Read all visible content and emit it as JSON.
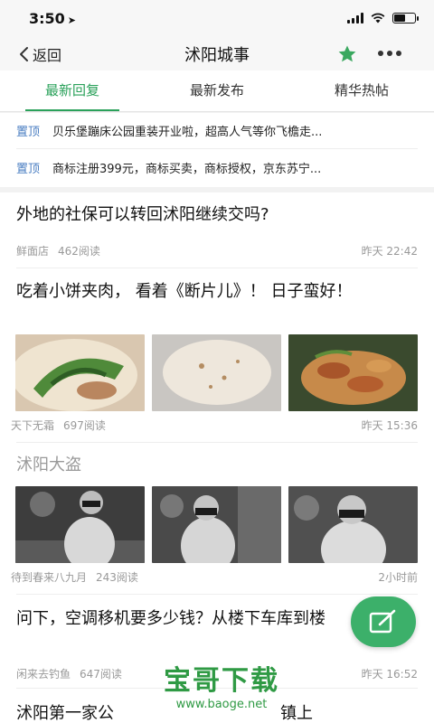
{
  "status_bar": {
    "time": "3:50",
    "battery_level": 0.55
  },
  "nav": {
    "back_label": "返回",
    "title": "沭阳城事"
  },
  "colors": {
    "accent": "#2aa15a",
    "pin_tag": "#4a7ec2",
    "fab": "#3cb06a",
    "watermark": "#2f9a44"
  },
  "tabs": [
    {
      "label": "最新回复",
      "active": true
    },
    {
      "label": "最新发布",
      "active": false
    },
    {
      "label": "精华热帖",
      "active": false
    }
  ],
  "pinned": [
    {
      "tag": "置顶",
      "text": "贝乐堡蹦床公园重装开业啦，超高人气等你飞檐走..."
    },
    {
      "tag": "置顶",
      "text": "商标注册399元，商标买卖，商标授权，京东苏宁..."
    }
  ],
  "posts": [
    {
      "title": "外地的社保可以转回沭阳继续交吗?",
      "author": "鲜面店",
      "reads": "462阅读",
      "time": "昨天 22:42"
    },
    {
      "title": "吃着小饼夹肉， 看着《断片儿》！ 日子蛮好！",
      "author": "天下无霜",
      "reads": "697阅读",
      "time": "昨天 15:36"
    },
    {
      "title": "沭阳大盗",
      "author": "待到春来八九月",
      "reads": "243阅读",
      "time": "2小时前"
    },
    {
      "title": "问下，空调移机要多少钱？从楼下车库到楼",
      "author": "闲来去钓鱼",
      "reads": "647阅读",
      "time": "昨天 16:52"
    },
    {
      "title": "沭阳第一家公",
      "title_tail": "镇上"
    }
  ],
  "icons": {
    "back": "chevron-left-icon",
    "star": "star-icon",
    "more": "more-dots-icon",
    "compose": "compose-icon"
  },
  "watermark": {
    "main": "宝哥下载",
    "url": "www.baoge.net"
  }
}
